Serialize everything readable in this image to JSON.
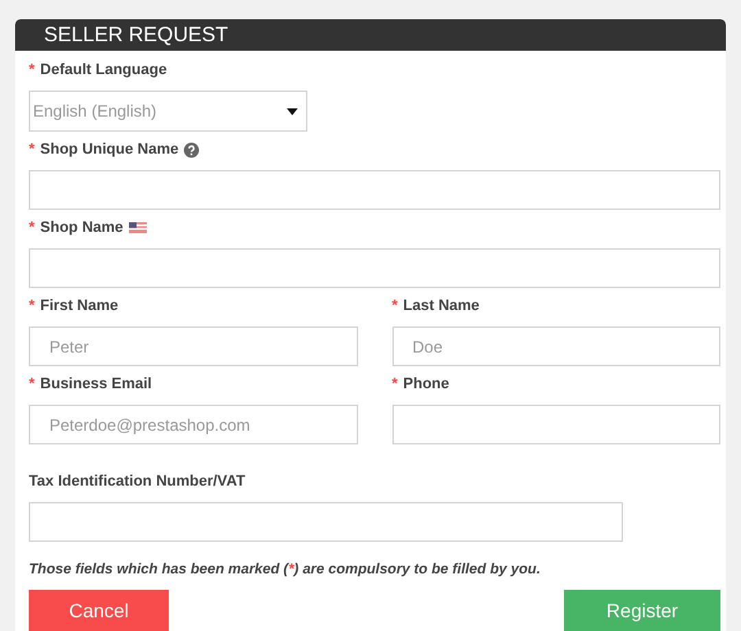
{
  "title": "SELLER REQUEST",
  "rows": [
    [
      {
        "kind": "select",
        "label": "Default Language",
        "marker": "*",
        "value": "English (English)"
      }
    ],
    [
      {
        "kind": "text",
        "label": "Shop Unique Name",
        "marker": "*",
        "help_icon": true
      }
    ],
    [
      {
        "kind": "text",
        "label": "Shop Name",
        "marker": "*",
        "flag_icon": true
      }
    ],
    [
      {
        "kind": "text",
        "label": "First Name",
        "marker": "*",
        "placeholder": "Peter"
      },
      {
        "kind": "text",
        "label": "Last Name",
        "marker": "*",
        "placeholder": "Doe"
      }
    ],
    [
      {
        "kind": "text",
        "label": "Business Email",
        "marker": "*",
        "placeholder": "Peterdoe@prestashop.com"
      },
      {
        "kind": "text",
        "label": "Phone",
        "marker": "*"
      }
    ],
    [
      {
        "kind": "wide",
        "label": "Tax Identification Number/VAT"
      }
    ]
  ],
  "note": {
    "before": "Those fields which has been marked (",
    "mark": "*",
    "after": ") are compulsory to be filled by you."
  },
  "buttons": [
    {
      "label": "Cancel",
      "kind": "cancel"
    },
    {
      "label": "Register",
      "kind": "submit"
    }
  ]
}
